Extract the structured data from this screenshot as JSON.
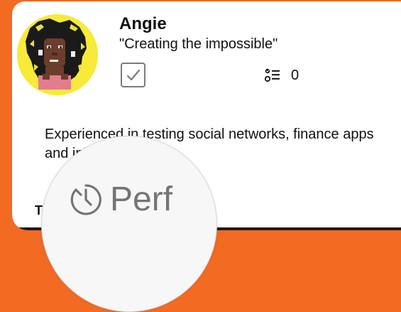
{
  "profile": {
    "name": "Angie",
    "tagline": "\"Creating the impossible\""
  },
  "stats": {
    "tasks_icon": "checklist-icon",
    "tasks_count": "0",
    "check_icon": "checkbox-check-icon"
  },
  "description": "Experienced in testing social networks, finance apps and infrastructure.",
  "section": {
    "heading": "Tes"
  },
  "magnifier": {
    "icon": "timer-icon",
    "label": "Perf"
  },
  "colors": {
    "background": "#f36a22",
    "avatar_background": "#f7ea3a",
    "muted": "#747474"
  }
}
